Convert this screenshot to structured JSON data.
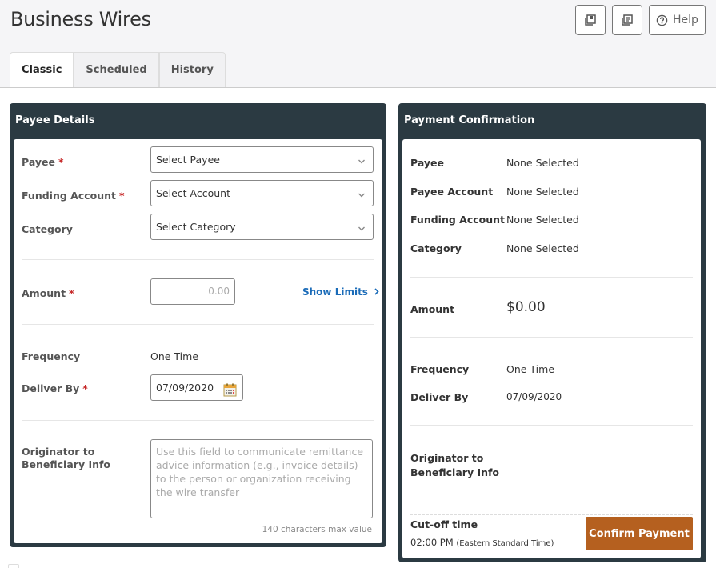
{
  "header": {
    "title": "Business Wires",
    "buttons": [
      {
        "icon": "save-copy-icon"
      },
      {
        "icon": "document-list-icon"
      },
      {
        "icon": "help-circle-icon",
        "label": "Help"
      }
    ]
  },
  "tabs": [
    {
      "label": "Classic",
      "active": true
    },
    {
      "label": "Scheduled",
      "active": false
    },
    {
      "label": "History",
      "active": false
    }
  ],
  "payee_details": {
    "title": "Payee Details",
    "payee": {
      "label": "Payee",
      "required_mark": "*",
      "value": "Select Payee"
    },
    "funding_account": {
      "label": "Funding Account",
      "required_mark": "*",
      "value": "Select Account"
    },
    "category": {
      "label": "Category",
      "value": "Select Category"
    },
    "amount": {
      "label": "Amount",
      "required_mark": "*",
      "placeholder": "0.00"
    },
    "show_limits": "Show Limits",
    "frequency": {
      "label": "Frequency",
      "value": "One Time"
    },
    "deliver_by": {
      "label": "Deliver By",
      "required_mark": "*",
      "value": "07/09/2020"
    },
    "originator": {
      "label_line1": "Originator to",
      "label_line2": "Beneficiary Info",
      "placeholder": "Use this field to communicate remittance advice information (e.g., invoice details) to the person or organization receiving the wire transfer",
      "hint": "140 characters max value"
    }
  },
  "payment_confirmation": {
    "title": "Payment Confirmation",
    "rows": [
      {
        "label": "Payee",
        "value": "None Selected"
      },
      {
        "label": "Payee Account",
        "value": "None Selected"
      },
      {
        "label": "Funding Account",
        "value": "None Selected"
      },
      {
        "label": "Category",
        "value": "None Selected"
      }
    ],
    "amount": {
      "label": "Amount",
      "value": "$0.00"
    },
    "frequency": {
      "label": "Frequency",
      "value": "One Time"
    },
    "deliver_by": {
      "label": "Deliver By",
      "value": "07/09/2020"
    },
    "originator": {
      "label_line1": "Originator to",
      "label_line2": "Beneficiary Info"
    },
    "cutoff": {
      "label": "Cut-off time",
      "time": "02:00 PM",
      "zone": "(Eastern Standard Time)"
    },
    "confirm_label": "Confirm Payment"
  },
  "colors": {
    "panel_header": "#2b3a42",
    "link": "#1a6bb8",
    "confirm_button": "#b5601f",
    "required": "#c62828"
  }
}
